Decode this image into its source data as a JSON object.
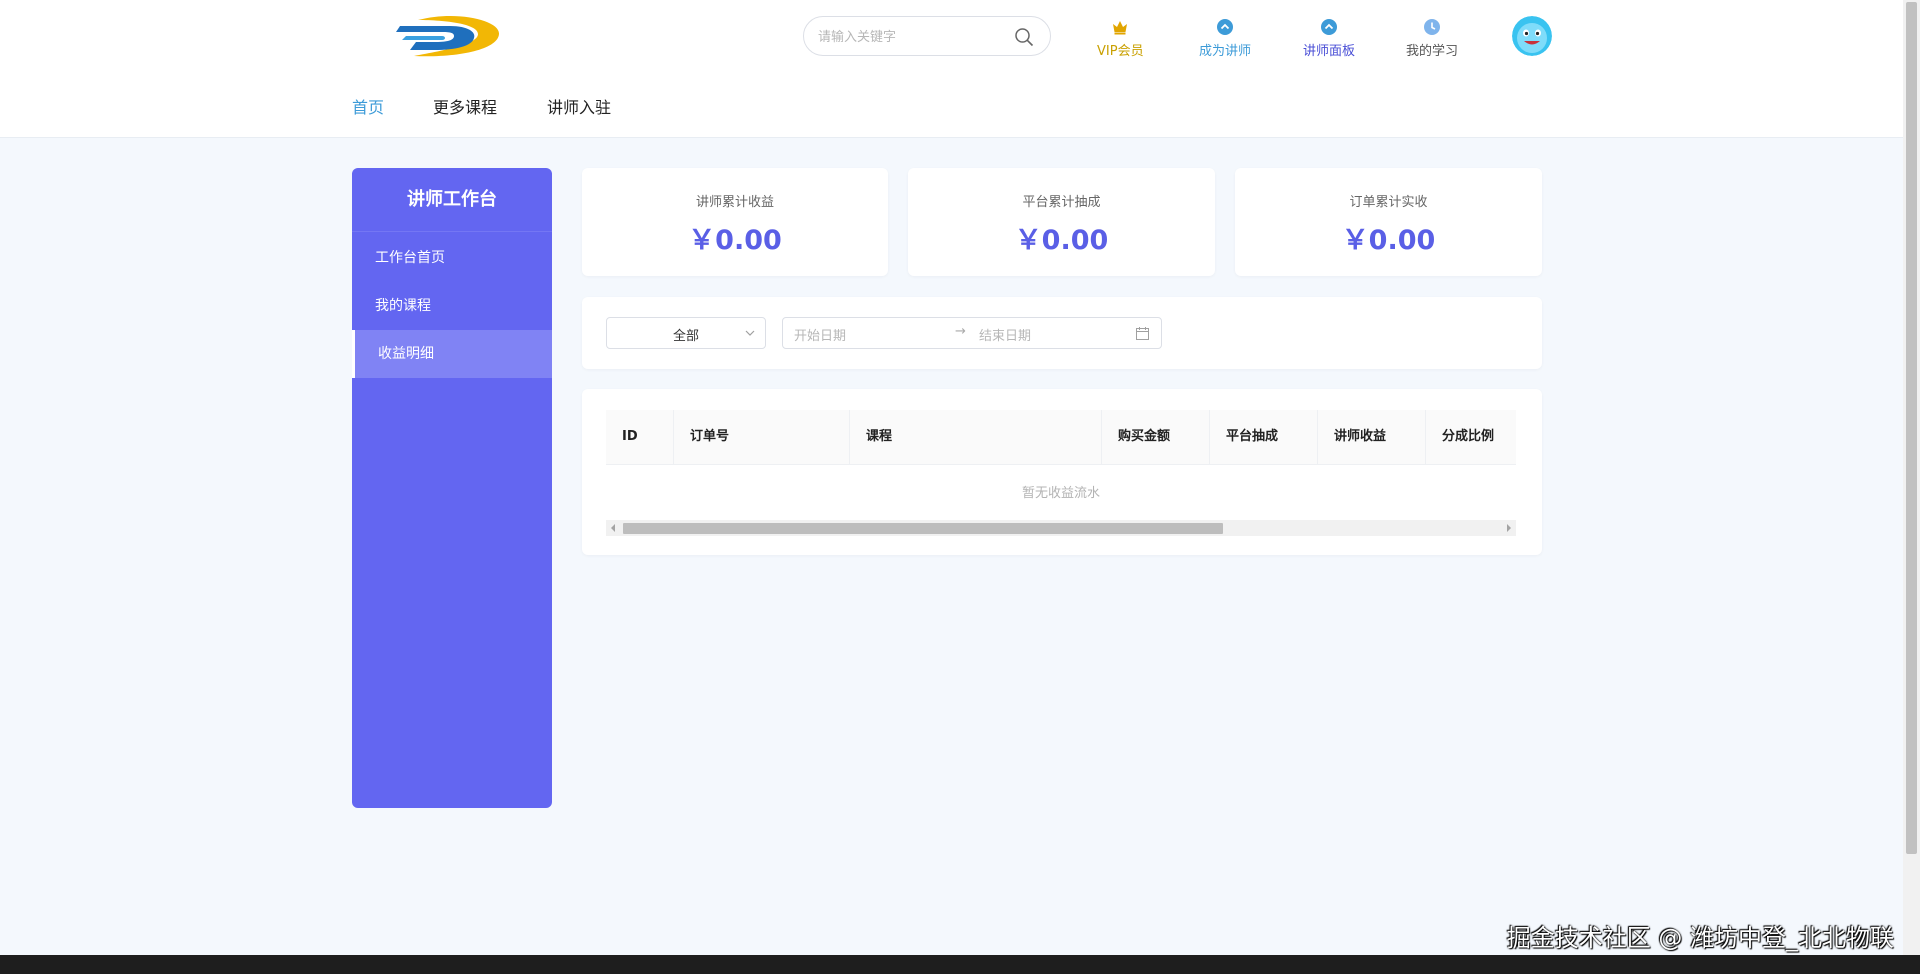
{
  "header": {
    "search": {
      "placeholder": "请输入关键字"
    },
    "links": [
      {
        "label": "VIP会员",
        "icon": "crown-icon",
        "color": "#c9a000"
      },
      {
        "label": "成为讲师",
        "icon": "chevron-up-circle-icon",
        "color": "#3d9bd8"
      },
      {
        "label": "讲师面板",
        "icon": "chevron-up-circle-icon",
        "color": "#4a4fd6"
      },
      {
        "label": "我的学习",
        "icon": "clock-icon",
        "color": "#555555"
      }
    ],
    "menu": [
      "首页",
      "更多课程",
      "讲师入驻"
    ]
  },
  "sidebar": {
    "title": "讲师工作台",
    "items": [
      "工作台首页",
      "我的课程",
      "收益明细"
    ],
    "active_index": 2
  },
  "stats": [
    {
      "label": "讲师累计收益",
      "value": "￥0.00"
    },
    {
      "label": "平台累计抽成",
      "value": "￥0.00"
    },
    {
      "label": "订单累计实收",
      "value": "￥0.00"
    }
  ],
  "filters": {
    "select_value": "全部",
    "start_placeholder": "开始日期",
    "end_placeholder": "结束日期",
    "separator": "→"
  },
  "table": {
    "columns": [
      "ID",
      "订单号",
      "课程",
      "购买金额",
      "平台抽成",
      "讲师收益",
      "分成比例"
    ],
    "empty_text": "暂无收益流水"
  },
  "watermark": "掘金技术社区 @ 潍坊中登_北北物联",
  "colors": {
    "accent": "#6366f1",
    "stat_value": "#5a5fe6",
    "active_menu": "#3d9bd8"
  }
}
